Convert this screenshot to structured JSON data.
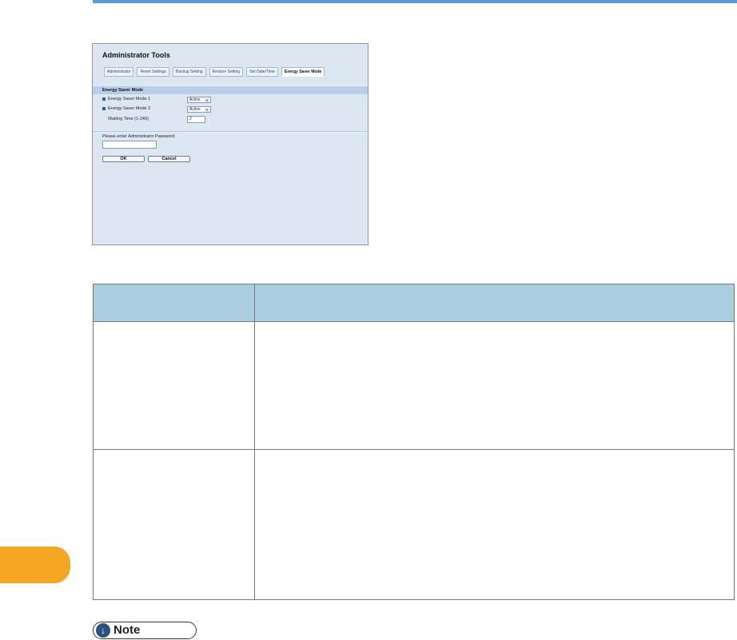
{
  "screenshot": {
    "title": "Administrator Tools",
    "tabs": [
      {
        "label": "Administrator"
      },
      {
        "label": "Reset Settings"
      },
      {
        "label": "Backup Setting"
      },
      {
        "label": "Restore Setting"
      },
      {
        "label": "Set Date/Time"
      },
      {
        "label": "Energy Saver Mode",
        "active": true
      }
    ],
    "section_title": "Energy Saver Mode",
    "fields": [
      {
        "label": "Energy Saver Mode 1",
        "value": "Active"
      },
      {
        "label": "Energy Saver Mode 2",
        "value": "Active"
      }
    ],
    "waiting_time": {
      "label": "Waiting Time (1-240)",
      "value": "2"
    },
    "password_prompt": "Please enter Administrator Password.",
    "password_value": "",
    "ok_label": "OK",
    "cancel_label": "Cancel"
  },
  "table": {
    "headers": [
      "",
      ""
    ],
    "rows": [
      [
        "",
        ""
      ],
      [
        "",
        ""
      ]
    ]
  },
  "note": {
    "label": "Note",
    "icon": "down-arrow-icon"
  },
  "colors": {
    "accent": "#5b9bd5",
    "chapter_tab": "#f5a623",
    "table_header": "#a9cfe0"
  }
}
